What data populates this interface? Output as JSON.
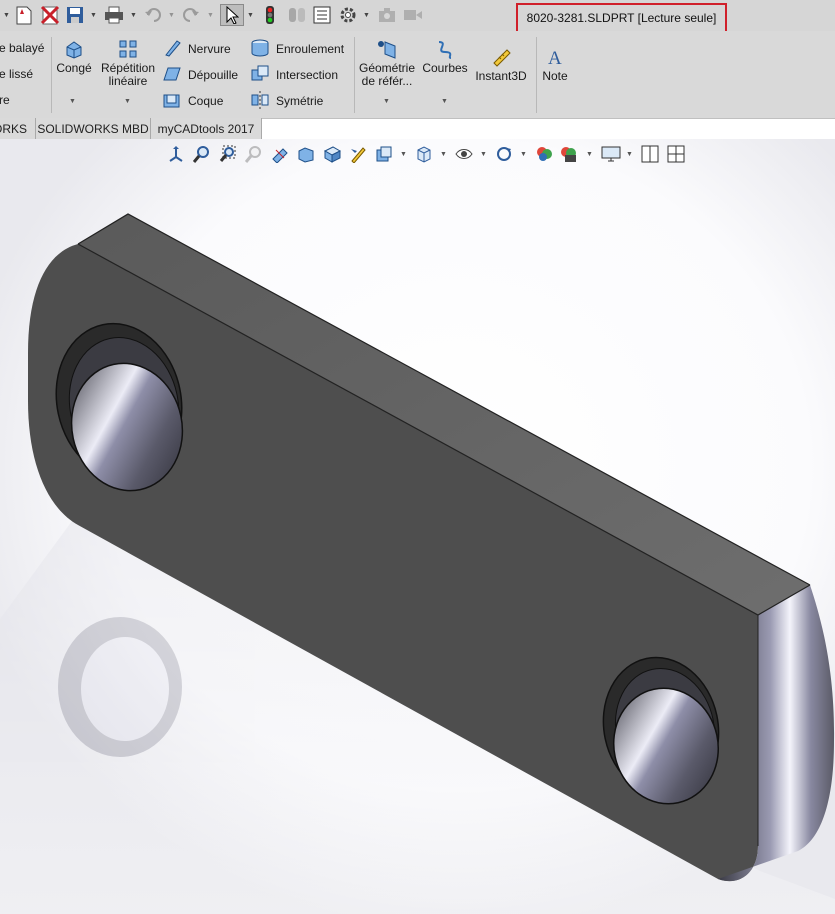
{
  "title_bar": {
    "document_title": "8020-3281.SLDPRT [Lecture seule]"
  },
  "ribbon": {
    "partial_items": [
      "e balayé",
      "e lissé",
      "re"
    ],
    "conge_label": "Congé",
    "repetition_label_1": "Répétition",
    "repetition_label_2": "linéaire",
    "nervure_label": "Nervure",
    "depouille_label": "Dépouille",
    "coque_label": "Coque",
    "enroulement_label": "Enroulement",
    "intersection_label": "Intersection",
    "symetrie_label": "Symétrie",
    "geometrie_label_1": "Géométrie",
    "geometrie_label_2": "de référ...",
    "courbes_label": "Courbes",
    "instant3d_label": "Instant3D",
    "note_label": "Note"
  },
  "tabs": [
    "ORKS",
    "SOLIDWORKS MBD",
    "myCADtools 2017"
  ],
  "colors": {
    "title_highlight": "#d0202a",
    "part_body": "#4e4e4e"
  }
}
